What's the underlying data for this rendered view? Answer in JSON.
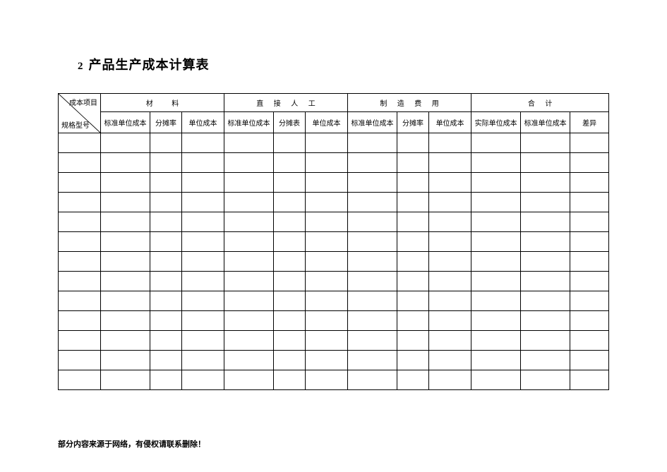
{
  "title": {
    "number": "2",
    "text": "产品生产成本计算表"
  },
  "table": {
    "corner": {
      "top": "成本项目",
      "bottom": "规格型号"
    },
    "groups": [
      "材    料",
      "直 接 人 工",
      "制 造 费 用",
      "合  计"
    ],
    "columns": {
      "g1": [
        "标准单位成本",
        "分摊率",
        "单位成本"
      ],
      "g2": [
        "标准单位成本",
        "分摊表",
        "单位成本"
      ],
      "g3": [
        "标准单位成本",
        "分摊率",
        "单位成本"
      ],
      "g4": [
        "实际单位成本",
        "标准单位成本",
        "差异"
      ]
    },
    "body_rows": 13
  },
  "footer": "部分内容来源于网络，有侵权请联系删除！"
}
